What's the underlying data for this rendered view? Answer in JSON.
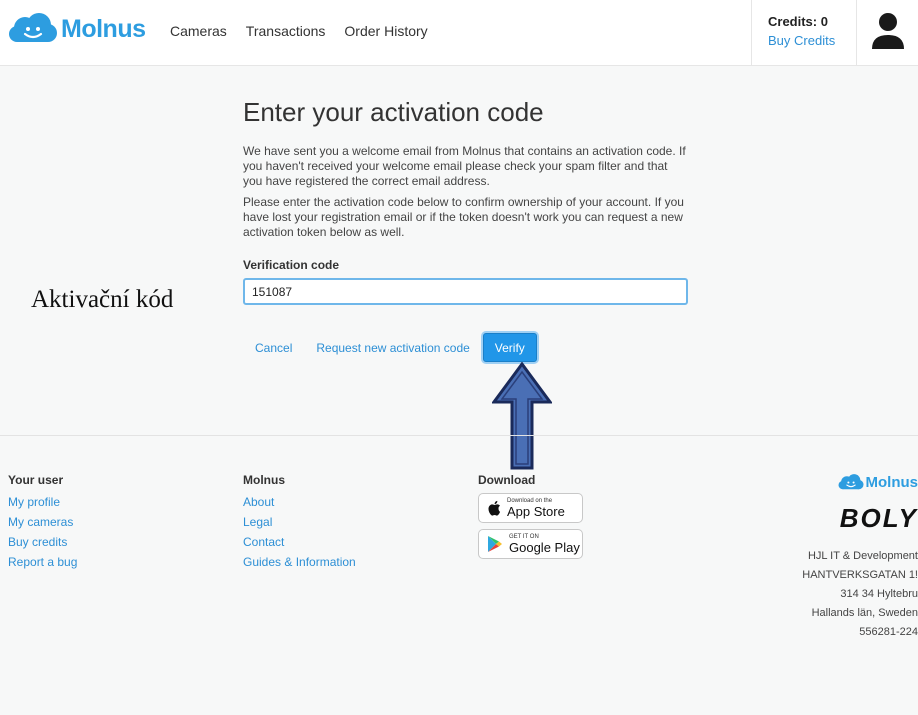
{
  "header": {
    "logo_text": "Molnus",
    "nav": [
      "Cameras",
      "Transactions",
      "Order History"
    ],
    "credits_label": "Credits: 0",
    "buy_credits": "Buy Credits"
  },
  "main": {
    "title": "Enter your activation code",
    "para1": "We have sent you a welcome email from Molnus that contains an activation code. If you haven't received your welcome email please check your spam filter and that you have registered the correct email address.",
    "para2": "Please enter the activation code below to confirm ownership of your account. If you have lost your registration email or if the token doesn't work you can request a new activation token below as well.",
    "field_label": "Verification code",
    "code_value": "151087",
    "cancel": "Cancel",
    "request_new": "Request new activation code",
    "verify": "Verify"
  },
  "annotation": {
    "label": "Aktivační kód"
  },
  "footer": {
    "your_user": {
      "heading": "Your user",
      "links": [
        "My profile",
        "My cameras",
        "Buy credits",
        "Report a bug"
      ]
    },
    "molnus": {
      "heading": "Molnus",
      "links": [
        "About",
        "Legal",
        "Contact",
        "Guides & Information"
      ]
    },
    "download": {
      "heading": "Download",
      "app_store_small": "Download on the",
      "app_store_big": "App Store",
      "google_small": "GET IT ON",
      "google_big": "Google Play"
    },
    "brand": {
      "logo_text": "Molnus",
      "boly": "BOLY",
      "address": [
        "HJL IT & Development",
        "HANTVERKSGATAN 1!",
        "314 34 Hyltebru",
        "Hallands län, Sweden",
        "556281-224"
      ]
    }
  },
  "colors": {
    "accent": "#2d8fd5",
    "brand_blue": "#2d9de0",
    "verify_bg": "#2196e8",
    "arrow_fill": "#4a6fb5",
    "arrow_border": "#1a2a5a"
  }
}
